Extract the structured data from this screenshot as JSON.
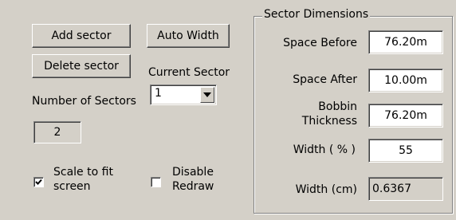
{
  "buttons": {
    "add_sector": "Add sector",
    "auto_width": "Auto Width",
    "delete_sector": "Delete sector"
  },
  "current_sector": {
    "label": "Current Sector",
    "value": "1"
  },
  "number_of_sectors": {
    "label": "Number of Sectors",
    "value": "2"
  },
  "checkboxes": {
    "scale_to_fit": {
      "label_line1": "Scale to fit",
      "label_line2": "screen",
      "checked": true
    },
    "disable_redraw": {
      "label_line1": "Disable",
      "label_line2": "Redraw",
      "checked": false
    }
  },
  "sector_dimensions": {
    "title": "Sector Dimensions",
    "space_before": {
      "label": "Space Before",
      "value": "76.20m"
    },
    "space_after": {
      "label": "Space After",
      "value": "10.00m"
    },
    "bobbin_thickness": {
      "label_line1": "Bobbin",
      "label_line2": "Thickness",
      "value": "76.20m"
    },
    "width_percent": {
      "label": "Width ( % )",
      "value": "55"
    },
    "width_cm": {
      "label": "Width (cm)",
      "value": "0.6367"
    }
  },
  "icons": {
    "dropdown": "chevron-down-icon",
    "check": "checkmark-icon"
  }
}
